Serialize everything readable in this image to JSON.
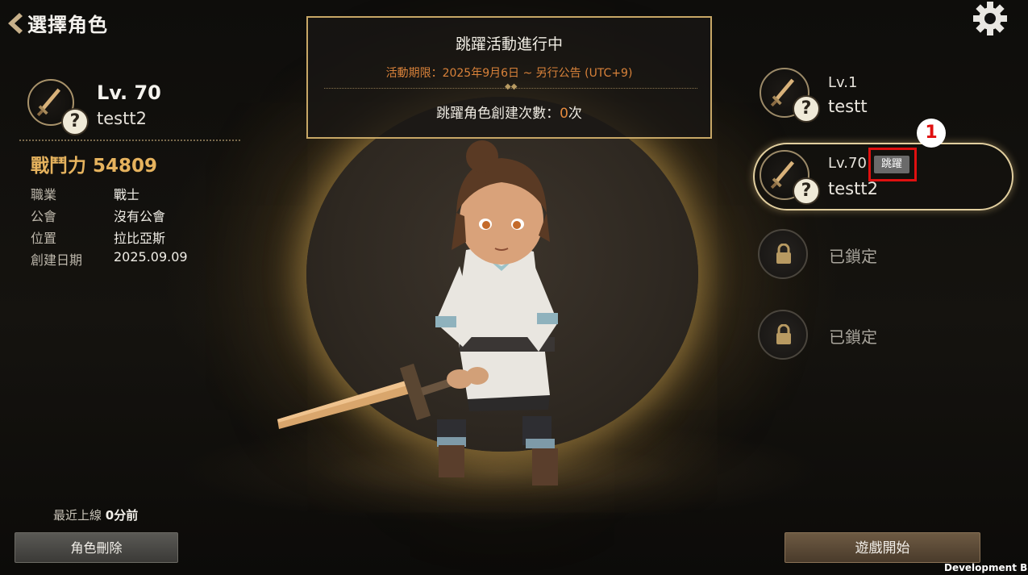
{
  "header": {
    "title": "選擇角色"
  },
  "selected_character": {
    "level": "Lv. 70",
    "name": "testt2",
    "power": "戰鬥力 54809",
    "info": [
      {
        "label": "職業",
        "value": "戰士"
      },
      {
        "label": "公會",
        "value": "沒有公會"
      },
      {
        "label": "位置",
        "value": "拉比亞斯"
      },
      {
        "label": "創建日期",
        "value": "2025.09.09"
      }
    ],
    "last_login_prefix": "最近上線",
    "last_login_value": "0分前"
  },
  "event": {
    "title": "跳躍活動進行中",
    "period": "活動期限：2025年9月6日 ~ 另行公告 (UTC+9)",
    "count_prefix": "跳躍角色創建次數：",
    "count_value": "0",
    "count_suffix": "次"
  },
  "slots": [
    {
      "level": "Lv.1",
      "name": "testt"
    },
    {
      "level": "Lv.70",
      "name": "testt2",
      "badge": "跳躍"
    },
    {
      "locked_label": "已鎖定"
    },
    {
      "locked_label": "已鎖定"
    }
  ],
  "annotation_marker": "1",
  "buttons": {
    "delete": "角色刪除",
    "start": "遊戲開始"
  },
  "watermark": "Development Buil",
  "colors": {
    "power": "#e6b35e",
    "event_period": "#d9823a",
    "highlight": "#e01010",
    "gold_border": "#c7a766"
  },
  "icons": [
    "back-chevron-icon",
    "gear-icon",
    "sword-icon",
    "question-icon",
    "lock-icon"
  ]
}
